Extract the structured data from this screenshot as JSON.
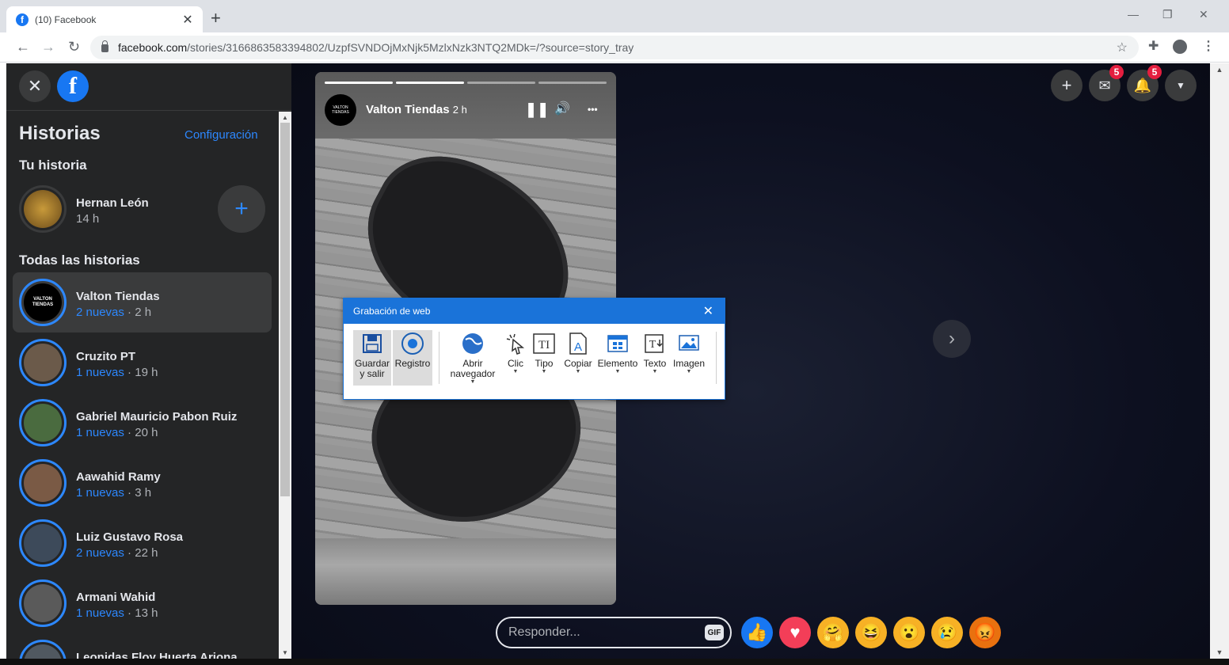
{
  "browser": {
    "tab_title": "(10) Facebook",
    "tab_close": "✕",
    "new_tab": "+",
    "url_host": "facebook.com",
    "url_path": "/stories/3166863583394802/UzpfSVNDOjMxNjk5MzlxNzk3NTQ2MDk=/?source=story_tray",
    "win_min": "—",
    "win_max": "❐",
    "win_close": "✕"
  },
  "sidebar": {
    "close": "✕",
    "logo": "f",
    "title": "Historias",
    "config": "Configuración",
    "your_story_heading": "Tu historia",
    "my_story": {
      "name": "Hernan León",
      "time": "14 h"
    },
    "add_story": "+",
    "all_heading": "Todas las historias",
    "stories": [
      {
        "name": "Valton Tiendas",
        "new": "2 nuevas",
        "time": " · 2 h",
        "avatar": "VALTON TIENDAS",
        "color": "#000000"
      },
      {
        "name": "Cruzito PT",
        "new": "1 nuevas",
        "time": " · 19 h",
        "avatar": "",
        "color": "#6b5a4a"
      },
      {
        "name": "Gabriel Mauricio Pabon Ruiz",
        "new": "1 nuevas",
        "time": " · 20 h",
        "avatar": "",
        "color": "#4a6b3f"
      },
      {
        "name": "Aawahid Ramy",
        "new": "1 nuevas",
        "time": " · 3 h",
        "avatar": "",
        "color": "#7a5a45"
      },
      {
        "name": "Luiz Gustavo Rosa",
        "new": "2 nuevas",
        "time": " · 22 h",
        "avatar": "",
        "color": "#3d4a5a"
      },
      {
        "name": "Armani Wahid",
        "new": "1 nuevas",
        "time": " · 13 h",
        "avatar": "",
        "color": "#5a5a5a"
      },
      {
        "name": "Leonidas Floy Huerta Ariona",
        "new": "",
        "time": "",
        "avatar": "",
        "color": "#505860"
      }
    ]
  },
  "topbar": {
    "plus": "+",
    "messenger_badge": "5",
    "notif_badge": "5",
    "menu": "▼"
  },
  "story_card": {
    "name": "Valton Tiendas",
    "time": "2 h",
    "avatar_text": "VALTON TIENDAS",
    "pause": "❚❚",
    "sound": "🔊",
    "more": "•••",
    "progress": [
      1,
      1,
      0,
      0
    ]
  },
  "next": "›",
  "reply": {
    "placeholder": "Responder...",
    "gif": "GIF"
  },
  "reactions": [
    {
      "name": "like",
      "glyph": "👍",
      "color": "#1877f2"
    },
    {
      "name": "love",
      "glyph": "♥",
      "color": "#f33e58"
    },
    {
      "name": "care",
      "glyph": "🤗",
      "color": "#f7b125"
    },
    {
      "name": "haha",
      "glyph": "😆",
      "color": "#f7b125"
    },
    {
      "name": "wow",
      "glyph": "😮",
      "color": "#f7b125"
    },
    {
      "name": "sad",
      "glyph": "😢",
      "color": "#f7b125"
    },
    {
      "name": "angry",
      "glyph": "😡",
      "color": "#e9710f"
    }
  ],
  "recorder": {
    "title": "Grabación de web",
    "close": "✕",
    "tools": [
      {
        "label": "Guardar\ny salir",
        "icon": "save-icon"
      },
      {
        "label": "Registro",
        "icon": "record-icon"
      },
      {
        "label": "Abrir\nnavegador",
        "icon": "browser-icon"
      },
      {
        "label": "Clic",
        "icon": "click-icon"
      },
      {
        "label": "Tipo",
        "icon": "type-icon"
      },
      {
        "label": "Copiar",
        "icon": "copy-icon"
      },
      {
        "label": "Elemento",
        "icon": "element-icon"
      },
      {
        "label": "Texto",
        "icon": "text-icon"
      },
      {
        "label": "Imagen",
        "icon": "image-icon"
      }
    ]
  }
}
